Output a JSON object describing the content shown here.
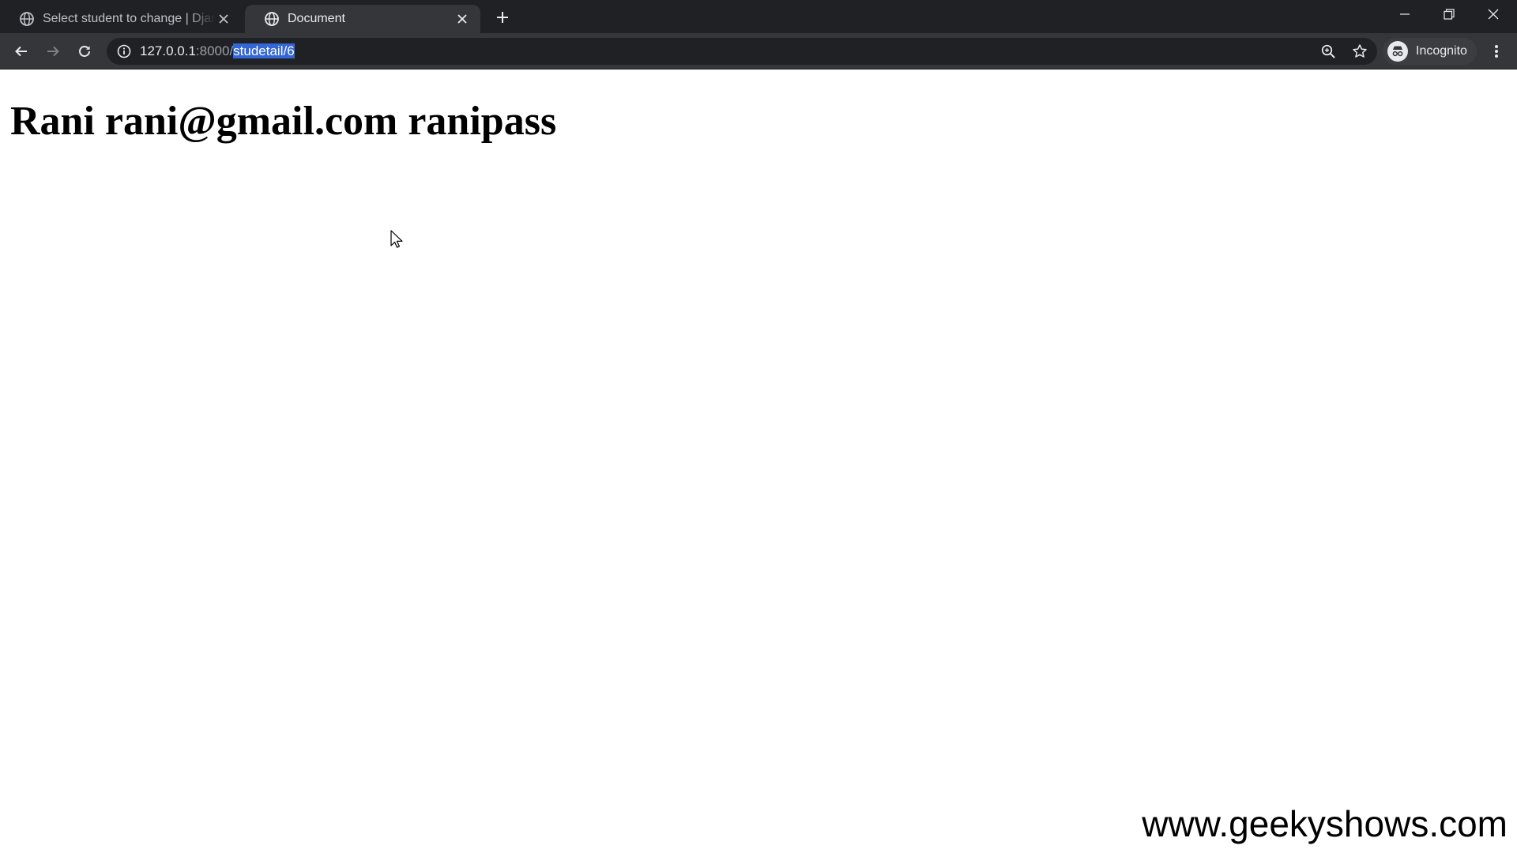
{
  "tabs": [
    {
      "title": "Select student to change | Django site admin",
      "active": false
    },
    {
      "title": "Document",
      "active": true
    }
  ],
  "address_bar": {
    "host": "127.0.0.1",
    "port": ":8000/",
    "path_selected": "studetail/6"
  },
  "profile": {
    "label": "Incognito"
  },
  "page": {
    "heading": "Rani rani@gmail.com ranipass"
  },
  "watermark": "www.geekyshows.com",
  "icons": {
    "tab_favicon": "globe-icon",
    "info": "info-icon",
    "zoom": "zoom-icon",
    "bookmark": "star-icon",
    "profile": "incognito-icon",
    "menu": "kebab-menu-icon"
  },
  "colors": {
    "tabstrip_bg": "#202124",
    "toolbar_bg": "#35363a",
    "omnibox_bg": "#202124",
    "selection": "#3367d6",
    "page_bg": "#ffffff"
  }
}
